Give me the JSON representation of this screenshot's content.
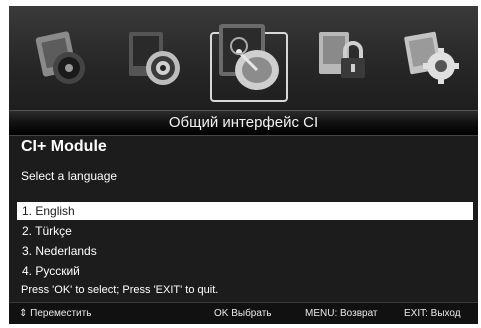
{
  "menu_icons": [
    "media-player-icon",
    "recording-icon",
    "satellite-dish-icon",
    "lock-icon",
    "settings-gear-icon"
  ],
  "header": {
    "title": "Общий интерфейс CI"
  },
  "module": {
    "title": "CI+ Module",
    "prompt": "Select a language",
    "languages": [
      {
        "label": "1. English",
        "selected": true
      },
      {
        "label": "2. Türkçe",
        "selected": false
      },
      {
        "label": "3. Nederlands",
        "selected": false
      },
      {
        "label": "4. Русский",
        "selected": false
      }
    ],
    "hint": "Press 'OK' to select; Press 'EXIT' to quit."
  },
  "footer": {
    "move": "⇕ Переместить",
    "ok": "OK Выбрать",
    "menu": "MENU: Возврат",
    "exit": "EXIT: Выход"
  },
  "colors": {
    "background": "#1c1c1c",
    "highlight": "#ffffff",
    "text": "#ffffff"
  }
}
